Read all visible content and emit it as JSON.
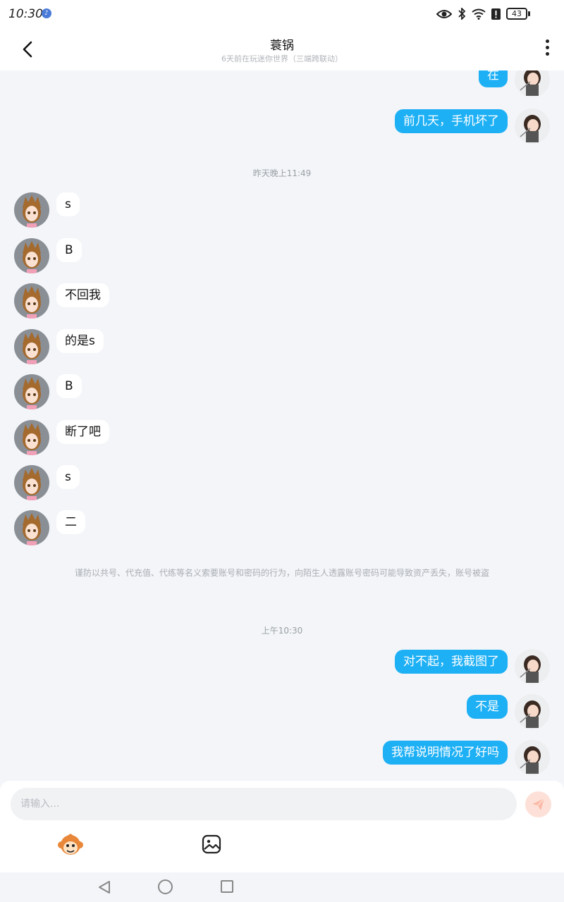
{
  "status": {
    "time": "10:30",
    "battery": "43"
  },
  "header": {
    "title": "蓑锅",
    "subtitle": "6天前在玩迷你世界（三端跨联动）"
  },
  "messages": {
    "m1": "在",
    "m2": "前几天，手机坏了",
    "t1": "昨天晚上11:49",
    "m3": "s",
    "m4": "B",
    "m5": "不回我",
    "m6": "的是s",
    "m7": "B",
    "m8": "断了吧",
    "m9": "s",
    "m10": "二",
    "warning": "谨防以共号、代充值、代练等名义索要账号和密码的行为，向陌生人透露账号密码可能导致资产丢失，账号被盗",
    "t2": "上午10:30",
    "m11": "对不起，我截图了",
    "m12": "不是",
    "m13": "我帮说明情况了好吗"
  },
  "input": {
    "placeholder": "请输入..."
  },
  "colors": {
    "bubble_self": "#1eb0f5",
    "bubble_other": "#ffffff",
    "background": "#f3f5f8",
    "send_disabled": "#fde1d9"
  },
  "icons": {
    "back": "chevron-left-icon",
    "more": "more-vertical-icon",
    "send": "paper-plane-icon",
    "emoji": "monkey-emoji-icon",
    "image": "image-icon"
  }
}
